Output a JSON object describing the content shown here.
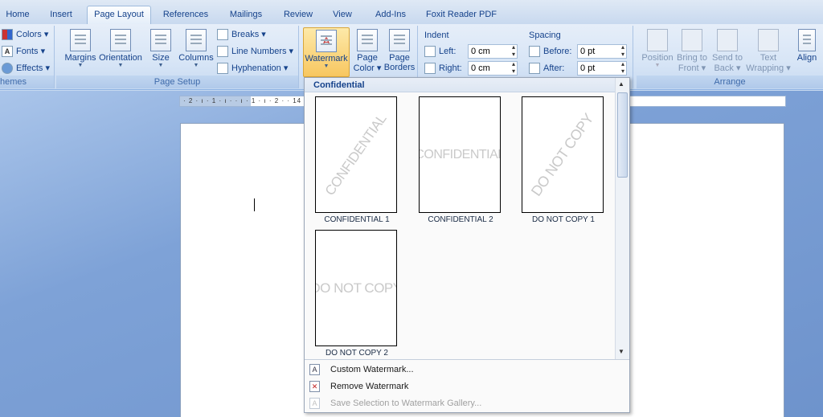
{
  "tabs": [
    "Home",
    "Insert",
    "Page Layout",
    "References",
    "Mailings",
    "Review",
    "View",
    "Add-Ins",
    "Foxit Reader PDF"
  ],
  "active_tab": "Page Layout",
  "ribbon": {
    "themes": {
      "colors": "Colors",
      "fonts": "Fonts",
      "effects": "Effects",
      "label": "hemes"
    },
    "page_setup": {
      "margins": "Margins",
      "orientation": "Orientation",
      "size": "Size",
      "columns": "Columns",
      "breaks": "Breaks",
      "line_numbers": "Line Numbers",
      "hyphenation": "Hyphenation",
      "label": "Page Setup"
    },
    "page_background": {
      "watermark": "Watermark",
      "page_color_1": "Page",
      "page_color_2": "Color",
      "page_borders_1": "Page",
      "page_borders_2": "Borders"
    },
    "paragraph": {
      "indent_label": "Indent",
      "left_label": "Left:",
      "left_value": "0 cm",
      "right_label": "Right:",
      "right_value": "0 cm",
      "spacing_label": "Spacing",
      "before_label": "Before:",
      "before_value": "0 pt",
      "after_label": "After:",
      "after_value": "0 pt"
    },
    "arrange": {
      "position": "Position",
      "bring_1": "Bring to",
      "bring_2": "Front",
      "send_1": "Send to",
      "send_2": "Back",
      "text_1": "Text",
      "text_2": "Wrapping",
      "align": "Align",
      "label": "Arrange"
    }
  },
  "ruler": "· 2 · ı · 1 · ı ·   · ı · 1 · ı · 2 ·                                                                                         · 14 · ı · 15 · ı ·   · ı · 17 · ı · 18 ·",
  "gallery": {
    "header": "Confidential",
    "items": [
      {
        "label": "CONFIDENTIAL 1",
        "text": "CONFIDENTIAL",
        "diagonal": true
      },
      {
        "label": "CONFIDENTIAL 2",
        "text": "CONFIDENTIAL",
        "diagonal": false
      },
      {
        "label": "DO NOT COPY 1",
        "text": "DO NOT COPY",
        "diagonal": true
      },
      {
        "label": "DO NOT COPY 2",
        "text": "DO NOT COPY",
        "diagonal": false
      }
    ],
    "menu": {
      "custom": "Custom Watermark...",
      "remove": "Remove Watermark",
      "save": "Save Selection to Watermark Gallery..."
    }
  }
}
